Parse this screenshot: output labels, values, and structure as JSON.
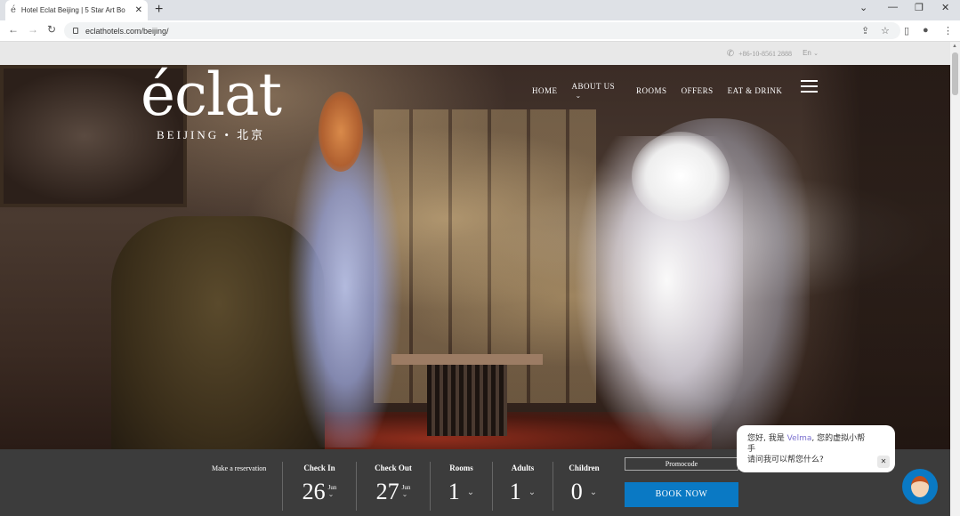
{
  "browser": {
    "tab_title": "Hotel Eclat Beijing | 5 Star Art Bo",
    "url": "eclathotels.com/beijing/"
  },
  "topbar": {
    "phone": "+86-10-8561 2888",
    "language": "En"
  },
  "logo": {
    "word": "éclat",
    "subtitle": "BEIJING • 北京"
  },
  "nav": {
    "items": [
      "HOME",
      "ABOUT US",
      "ROOMS",
      "OFFERS",
      "EAT & DRINK"
    ]
  },
  "reservation": {
    "title": "Make a reservation",
    "checkin_label": "Check In",
    "checkin_day": "26",
    "checkin_month": "Jun",
    "checkout_label": "Check Out",
    "checkout_day": "27",
    "checkout_month": "Jun",
    "rooms_label": "Rooms",
    "rooms_value": "1",
    "adults_label": "Adults",
    "adults_value": "1",
    "children_label": "Children",
    "children_value": "0",
    "promocode": "Promocode",
    "book_now": "BOOK NOW"
  },
  "chat": {
    "line1_prefix": "您好, 我是",
    "assistant_name": "Velma",
    "line1_suffix": ", 您的虚拟小帮",
    "line2": "手",
    "line3": "请问我可以帮您什么?"
  },
  "icons": {
    "favicon": "eclat-favicon-icon",
    "phone": "phone-icon",
    "close": "close-icon"
  },
  "colors": {
    "accent": "#0a79c4",
    "reservation_bar": "#3c3c3c"
  }
}
